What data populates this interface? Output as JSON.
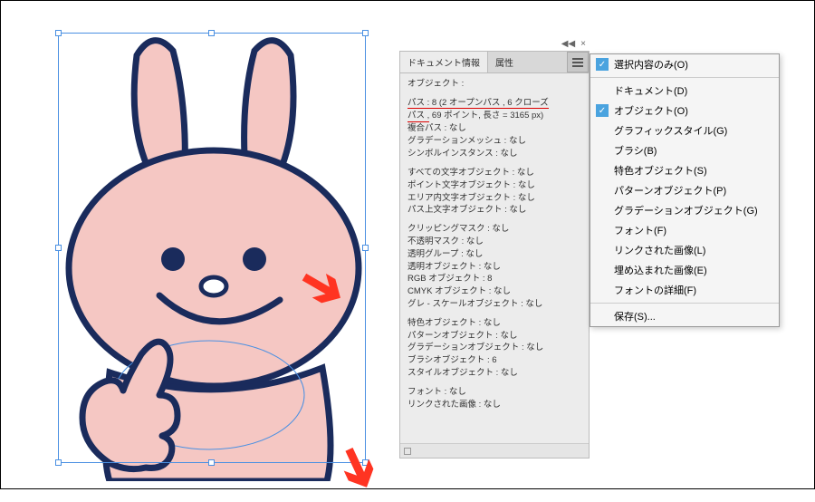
{
  "topright": {
    "collapse": "◀◀",
    "close": "×"
  },
  "tabs": {
    "docinfo": "ドキュメント情報",
    "attr": "属性"
  },
  "body": {
    "object_label": "オブジェクト :",
    "path_line1": "パス : 8 (2 オープンパス , 6 クローズ",
    "path_line2": "パス , 69 ポイント, 長さ = 3165 px)",
    "compound": "複合パス : なし",
    "gradmesh": "グラデーションメッシュ : なし",
    "symbol": "シンボルインスタンス : なし",
    "alltext": "すべての文字オブジェクト : なし",
    "pointtext": "ポイント文字オブジェクト : なし",
    "areatext": "エリア内文字オブジェクト : なし",
    "pathtext": "パス上文字オブジェクト : なし",
    "clipmask": "クリッピングマスク : なし",
    "opacitymask": "不透明マスク : なし",
    "transgroup": "透明グループ : なし",
    "transobj": "透明オブジェクト : なし",
    "rgbobj": "RGB オブジェクト : 8",
    "cmykobj": "CMYK オブジェクト : なし",
    "grayobj": "グレ - スケールオブジェクト : なし",
    "spotobj": "特色オブジェクト : なし",
    "patternobj": "パターンオブジェクト : なし",
    "gradobj": "グラデーションオブジェクト : なし",
    "brushobj": "ブラシオブジェクト : 6",
    "styleobj": "スタイルオブジェクト : なし",
    "font": "フォント : なし",
    "linked": "リンクされた画像 : なし"
  },
  "menu": {
    "selection_only": "選択内容のみ(O)",
    "document": "ドキュメント(D)",
    "object": "オブジェクト(O)",
    "graphicstyle": "グラフィックスタイル(G)",
    "brush": "ブラシ(B)",
    "spotobj": "特色オブジェクト(S)",
    "patternobj": "パターンオブジェクト(P)",
    "gradobj": "グラデーションオブジェクト(G)",
    "font": "フォント(F)",
    "linked": "リンクされた画像(L)",
    "embedded": "埋め込まれた画像(E)",
    "fontdetail": "フォントの詳細(F)",
    "save": "保存(S)..."
  },
  "colors": {
    "bunny_fill": "#f5c7c3",
    "bunny_stroke": "#1a2b5c",
    "arrow": "#ff3422"
  }
}
